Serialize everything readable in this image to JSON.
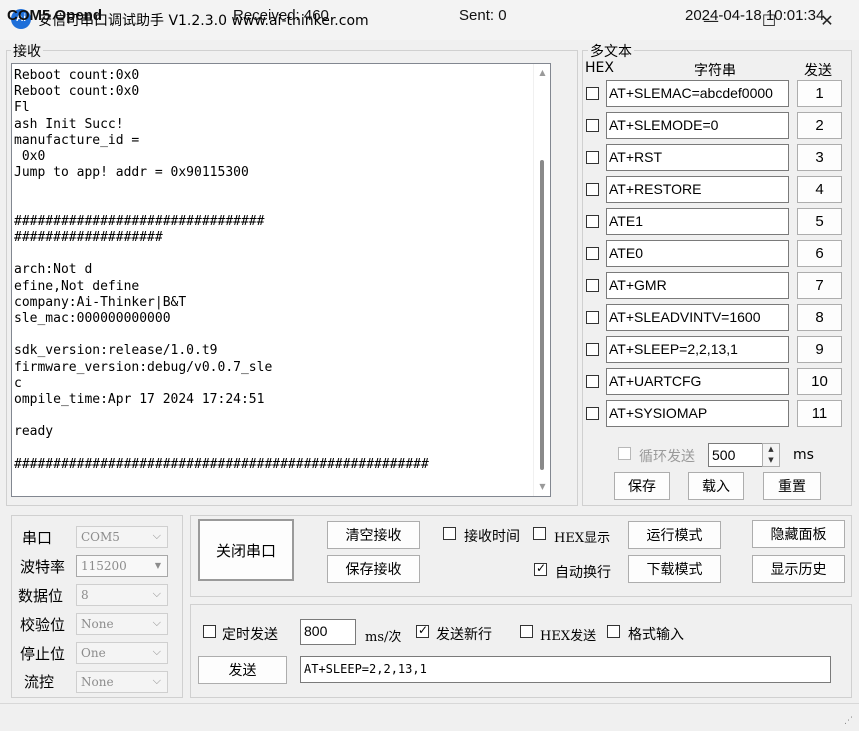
{
  "window": {
    "title": "安信可串口调试助手 V1.2.3.0    www.ai-thinker.com",
    "icon_text": "Ai",
    "minimize": "—",
    "maximize": "☐",
    "close": "✕"
  },
  "receive": {
    "label": "接收",
    "text": "Reboot count:0x0\nReboot count:0x0\nFl\nash Init Succ!\nmanufacture_id =\n 0x0\nJump to app! addr = 0x90115300\n\n\n################################\n###################\n\narch:Not d\nefine,Not define\ncompany:Ai-Thinker|B&T\nsle_mac:000000000000\n\nsdk_version:release/1.0.t9\nfirmware_version:debug/v0.0.7_sle\nc\nompile_time:Apr 17 2024 17:24:51\n\nready\n\n#####################################################"
  },
  "multitext": {
    "label": "多文本",
    "header_hex": "HEX",
    "header_string": "字符串",
    "header_send": "发送",
    "rows": [
      {
        "text": "AT+SLEMAC=abcdef0000",
        "num": "1"
      },
      {
        "text": "AT+SLEMODE=0",
        "num": "2"
      },
      {
        "text": "AT+RST",
        "num": "3"
      },
      {
        "text": "AT+RESTORE",
        "num": "4"
      },
      {
        "text": "ATE1",
        "num": "5"
      },
      {
        "text": "ATE0",
        "num": "6"
      },
      {
        "text": "AT+GMR",
        "num": "7"
      },
      {
        "text": "AT+SLEADVINTV=1600",
        "num": "8"
      },
      {
        "text": "AT+SLEEP=2,2,13,1",
        "num": "9"
      },
      {
        "text": "AT+UARTCFG",
        "num": "10"
      },
      {
        "text": "AT+SYSIOMAP",
        "num": "11"
      }
    ],
    "loop_label": "循环发送",
    "loop_interval": "500",
    "loop_unit": "ms",
    "save": "保存",
    "load": "载入",
    "reset": "重置"
  },
  "port_settings": {
    "port_label": "串口",
    "port_value": "COM5",
    "baud_label": "波特率",
    "baud_value": "115200",
    "databits_label": "数据位",
    "databits_value": "8",
    "parity_label": "校验位",
    "parity_value": "None",
    "stopbits_label": "停止位",
    "stopbits_value": "One",
    "flow_label": "流控",
    "flow_value": "None"
  },
  "controls": {
    "close_port": "关闭串口",
    "clear_receive": "清空接收",
    "save_receive": "保存接收",
    "recv_time": "接收时间",
    "hex_display": "HEX显示",
    "auto_wrap": "自动换行",
    "run_mode": "运行模式",
    "download_mode": "下载模式",
    "hide_panel": "隐藏面板",
    "show_history": "显示历史"
  },
  "send": {
    "timed_send": "定时发送",
    "interval": "800",
    "interval_unit": "ms/次",
    "send_newline": "发送新行",
    "hex_send": "HEX发送",
    "format_input": "格式输入",
    "send_button": "发送",
    "send_text": "AT+SLEEP=2,2,13,1"
  },
  "status": {
    "port": "COM5 Opend",
    "received": "Received: 460",
    "sent": "Sent: 0",
    "time": "2024-04-18 10:01:34"
  },
  "colors": {
    "accent": "#1e6fd9",
    "window_bg": "#f0f0f0"
  }
}
